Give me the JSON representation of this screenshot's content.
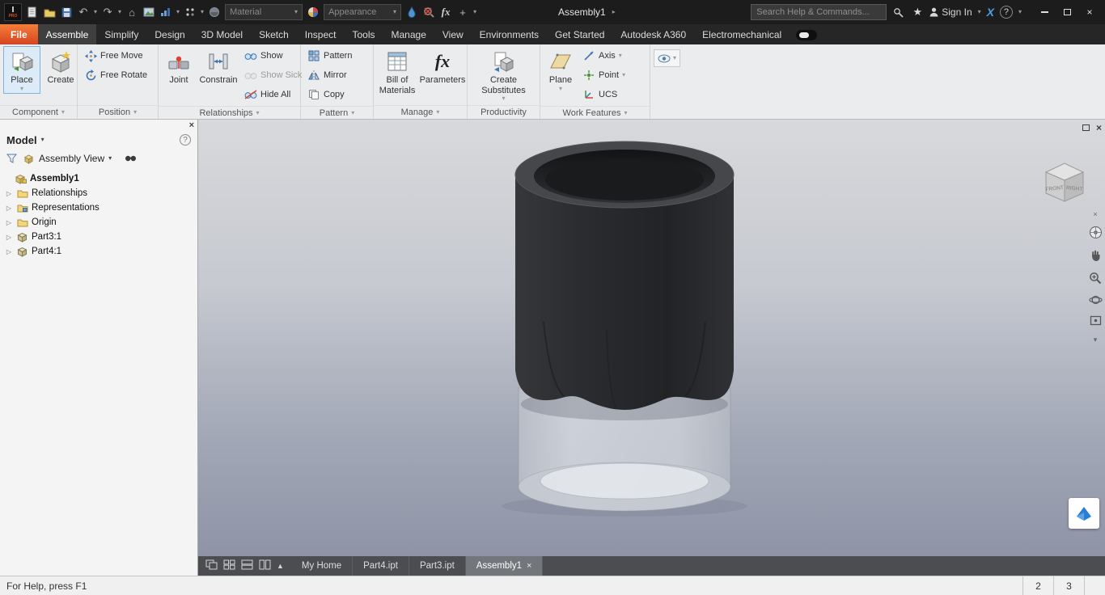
{
  "icons": {
    "caret_down": "▾",
    "caret_right": "▸",
    "close": "×",
    "star": "★",
    "undo": "↶",
    "redo": "↷",
    "home": "⌂",
    "plus": "+",
    "help": "?",
    "up_triangle": "▲",
    "expand_arrow": "▷",
    "fx": "fx",
    "exchange_x": "X"
  },
  "titlebar": {
    "doc_title": "Assembly1",
    "material_placeholder": "Material",
    "appearance_placeholder": "Appearance",
    "search_placeholder": "Search Help & Commands...",
    "sign_in_label": "Sign In"
  },
  "tabs": {
    "items": [
      "File",
      "Assemble",
      "Simplify",
      "Design",
      "3D Model",
      "Sketch",
      "Inspect",
      "Tools",
      "Manage",
      "View",
      "Environments",
      "Get Started",
      "Autodesk A360",
      "Electromechanical"
    ]
  },
  "ribbon": {
    "component": {
      "label": "Component",
      "place": "Place",
      "create": "Create"
    },
    "position": {
      "label": "Position",
      "free_move": "Free Move",
      "free_rotate": "Free Rotate"
    },
    "relationships": {
      "label": "Relationships",
      "joint": "Joint",
      "constrain": "Constrain",
      "show": "Show",
      "show_sick": "Show Sick",
      "hide_all": "Hide All"
    },
    "pattern": {
      "label": "Pattern",
      "pattern": "Pattern",
      "mirror": "Mirror",
      "copy": "Copy"
    },
    "manage": {
      "label": "Manage",
      "bom": "Bill of Materials",
      "parameters": "Parameters"
    },
    "productivity": {
      "label": "Productivity",
      "create_substitutes": "Create Substitutes"
    },
    "work_features": {
      "label": "Work Features",
      "plane": "Plane",
      "axis": "Axis",
      "point": "Point",
      "ucs": "UCS"
    }
  },
  "browser": {
    "panel_title": "Model",
    "view_selector": "Assembly View",
    "tree": {
      "root": "Assembly1",
      "items": [
        "Relationships",
        "Representations",
        "Origin",
        "Part3:1",
        "Part4:1"
      ]
    }
  },
  "viewport": {
    "viewcube": {
      "front": "FRONT",
      "right": "RIGHT"
    }
  },
  "doctabs": {
    "items": [
      "My Home",
      "Part4.ipt",
      "Part3.ipt",
      "Assembly1"
    ]
  },
  "statusbar": {
    "help_text": "For Help, press F1",
    "cell_a": "2",
    "cell_b": "3"
  }
}
